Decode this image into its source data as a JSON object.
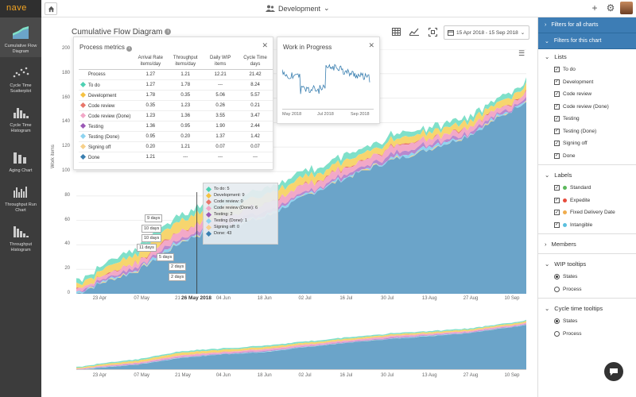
{
  "app": {
    "brand": "nave"
  },
  "nav": [
    {
      "name": "cfd",
      "label": "Cumulative Flow Diagram",
      "active": true
    },
    {
      "name": "ctscatter",
      "label": "Cycle Time Scatterplot"
    },
    {
      "name": "cthist",
      "label": "Cycle Time Histogram"
    },
    {
      "name": "aging",
      "label": "Aging Chart"
    },
    {
      "name": "throughputrun",
      "label": "Throughput Run Chart"
    },
    {
      "name": "throughputhist",
      "label": "Throughput Histogram"
    }
  ],
  "topbar": {
    "project": "Development"
  },
  "main": {
    "title": "Cumulative Flow Diagram",
    "date_range": "15 Apr 2018 - 15 Sep 2018",
    "ylabel": "Work items",
    "yticks": [
      "0",
      "20",
      "40",
      "60",
      "80",
      "100",
      "120",
      "140",
      "160",
      "180",
      "200"
    ],
    "xticks": [
      "23 Apr",
      "07 May",
      "21 May",
      "04 Jun",
      "18 Jun",
      "02 Jul",
      "16 Jul",
      "30 Jul",
      "13 Aug",
      "27 Aug",
      "10 Sep"
    ],
    "nav_xticks": [
      "23 Apr",
      "07 May",
      "21 May",
      "04 Jun",
      "18 Jun",
      "02 Jul",
      "16 Jul",
      "30 Jul",
      "13 Aug",
      "27 Aug",
      "10 Sep"
    ],
    "hover_date": "26 May 2018"
  },
  "process_metrics": {
    "title": "Process metrics",
    "headers": [
      "",
      "Arrival Rate items/day",
      "Throughput items/day",
      "Daily WIP items",
      "Cycle Time days"
    ],
    "rows": [
      {
        "name": "Process",
        "color": "",
        "arrival": "1.27",
        "throughput": "1.21",
        "wip": "12.21",
        "cycle": "21.42"
      },
      {
        "name": "To do",
        "color": "#4fd1b3",
        "arrival": "1.27",
        "throughput": "1.78",
        "wip": "---",
        "cycle": "8.24"
      },
      {
        "name": "Development",
        "color": "#f5c242",
        "arrival": "1.78",
        "throughput": "0.35",
        "wip": "5.06",
        "cycle": "5.57"
      },
      {
        "name": "Code review",
        "color": "#e8766a",
        "arrival": "0.35",
        "throughput": "1.23",
        "wip": "0.26",
        "cycle": "0.21"
      },
      {
        "name": "Code review (Done)",
        "color": "#f2a8c8",
        "arrival": "1.23",
        "throughput": "1.36",
        "wip": "3.55",
        "cycle": "3.47"
      },
      {
        "name": "Testing",
        "color": "#9b59b6",
        "arrival": "1.36",
        "throughput": "0.95",
        "wip": "1.90",
        "cycle": "2.44"
      },
      {
        "name": "Testing (Done)",
        "color": "#8fd4f0",
        "arrival": "0.95",
        "throughput": "0.20",
        "wip": "1.37",
        "cycle": "1.42"
      },
      {
        "name": "Signing off",
        "color": "#f7d08a",
        "arrival": "0.20",
        "throughput": "1.21",
        "wip": "0.07",
        "cycle": "0.07"
      },
      {
        "name": "Done",
        "color": "#3a7fb0",
        "arrival": "1.21",
        "throughput": "---",
        "wip": "---",
        "cycle": "---"
      }
    ]
  },
  "wip_popup": {
    "title": "Work in Progress",
    "xticks": [
      "May 2018",
      "Jul 2018",
      "Sep 2018"
    ]
  },
  "tooltip": {
    "items": [
      {
        "label": "To do: 5",
        "color": "#4fd1b3"
      },
      {
        "label": "Development: 9",
        "color": "#f5c242"
      },
      {
        "label": "Code review: 0",
        "color": "#e8766a"
      },
      {
        "label": "Code review (Done): 6",
        "color": "#f2a8c8"
      },
      {
        "label": "Testing: 2",
        "color": "#9b59b6"
      },
      {
        "label": "Testing (Done): 1",
        "color": "#8fd4f0"
      },
      {
        "label": "Signing off: 0",
        "color": "#f7d08a"
      },
      {
        "label": "Done: 43",
        "color": "#3a7fb0"
      }
    ]
  },
  "cycle_labels": [
    "9 days",
    "10 days",
    "10 days",
    "11 days",
    "5 days",
    "2 days",
    "2 days"
  ],
  "right_panel": {
    "all_charts": "Filters for all charts",
    "this_chart": "Filters for this chart",
    "lists_title": "Lists",
    "lists": [
      "To do",
      "Development",
      "Code review",
      "Code review (Done)",
      "Testing",
      "Testing (Done)",
      "Signing off",
      "Done"
    ],
    "labels_title": "Labels",
    "labels": [
      {
        "name": "Standard",
        "color": "#5cb85c"
      },
      {
        "name": "Expedite",
        "color": "#e74c3c"
      },
      {
        "name": "Fixed Delivery Date",
        "color": "#f0ad4e"
      },
      {
        "name": "Intangible",
        "color": "#5bc0de"
      }
    ],
    "members_title": "Members",
    "wip_tooltips_title": "WIP tooltips",
    "wip_tooltips": [
      {
        "label": "States",
        "on": true
      },
      {
        "label": "Process",
        "on": false
      }
    ],
    "ct_tooltips_title": "Cycle time tooltips",
    "ct_tooltips": [
      {
        "label": "States",
        "on": true
      },
      {
        "label": "Process",
        "on": false
      }
    ]
  },
  "chart_data": {
    "type": "area",
    "title": "Cumulative Flow Diagram",
    "xlabel": "",
    "ylabel": "Work items",
    "ylim": [
      0,
      200
    ],
    "x": [
      "15 Apr",
      "23 Apr",
      "07 May",
      "21 May",
      "04 Jun",
      "18 Jun",
      "02 Jul",
      "16 Jul",
      "30 Jul",
      "13 Aug",
      "27 Aug",
      "10 Sep",
      "15 Sep"
    ],
    "series": [
      {
        "name": "Done",
        "color": "#6ba4c9",
        "values": [
          0,
          8,
          20,
          43,
          55,
          62,
          80,
          95,
          108,
          118,
          130,
          150,
          158
        ]
      },
      {
        "name": "Signing off",
        "color": "#f7d08a",
        "values": [
          0,
          0,
          0,
          0,
          0,
          0,
          0,
          0,
          0,
          0,
          0,
          0,
          0
        ]
      },
      {
        "name": "Testing (Done)",
        "color": "#8fd4f0",
        "values": [
          1,
          1,
          1,
          1,
          1,
          2,
          1,
          1,
          1,
          2,
          1,
          1,
          1
        ]
      },
      {
        "name": "Testing",
        "color": "#b889cf",
        "values": [
          1,
          2,
          2,
          2,
          2,
          3,
          2,
          2,
          3,
          2,
          2,
          2,
          2
        ]
      },
      {
        "name": "Code review (Done)",
        "color": "#f2a8c8",
        "values": [
          2,
          3,
          4,
          6,
          5,
          6,
          6,
          5,
          6,
          5,
          4,
          4,
          4
        ]
      },
      {
        "name": "Code review",
        "color": "#e8766a",
        "values": [
          0,
          0,
          0,
          0,
          0,
          0,
          0,
          0,
          0,
          0,
          0,
          0,
          0
        ]
      },
      {
        "name": "Development",
        "color": "#f7d56e",
        "values": [
          3,
          5,
          7,
          9,
          8,
          7,
          6,
          6,
          5,
          5,
          5,
          5,
          5
        ]
      },
      {
        "name": "To do",
        "color": "#7fe0c9",
        "values": [
          3,
          4,
          5,
          5,
          5,
          5,
          5,
          5,
          4,
          4,
          4,
          4,
          4
        ]
      }
    ]
  }
}
